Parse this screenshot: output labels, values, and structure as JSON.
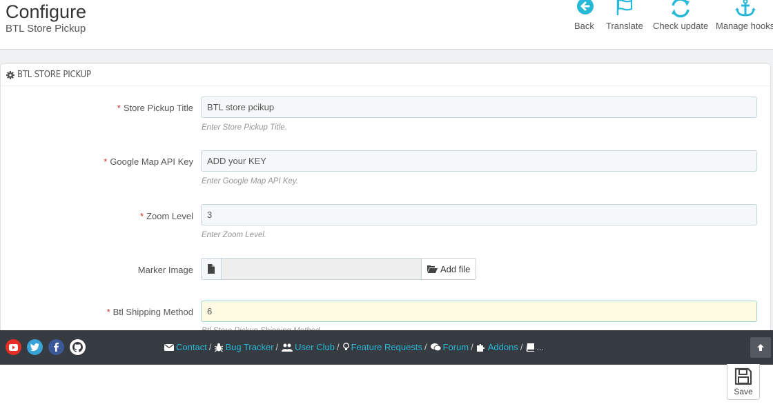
{
  "header": {
    "title": "Configure",
    "subtitle": "BTL Store Pickup",
    "toolbar": [
      {
        "label": "Back",
        "icon": "back-arrow-icon"
      },
      {
        "label": "Translate",
        "icon": "flag-icon"
      },
      {
        "label": "Check update",
        "icon": "refresh-icon"
      },
      {
        "label": "Manage hooks",
        "icon": "anchor-icon"
      }
    ]
  },
  "panel": {
    "heading": "BTL STORE PICKUP",
    "fields": {
      "title": {
        "label": "Store Pickup Title",
        "value": "BTL store pcikup",
        "help": "Enter Store Pickup Title."
      },
      "api_key": {
        "label": "Google Map API Key",
        "value": "ADD your KEY",
        "help": "Enter Google Map API Key."
      },
      "zoom": {
        "label": "Zoom Level",
        "value": "3",
        "help": "Enter Zoom Level."
      },
      "marker": {
        "label": "Marker Image",
        "button": "Add file"
      },
      "shipping": {
        "label": "Btl Shipping Method",
        "value": "6",
        "help": "Btl Store Pickup Shipping Method"
      }
    }
  },
  "footer": {
    "links": [
      "Contact",
      "Bug Tracker",
      "User Club",
      "Feature Requests",
      "Forum",
      "Addons"
    ],
    "more": "..."
  },
  "save_label": "Save",
  "colors": {
    "accent": "#25b9d7",
    "footer_bg": "#363a41",
    "required": "#c9302c"
  }
}
